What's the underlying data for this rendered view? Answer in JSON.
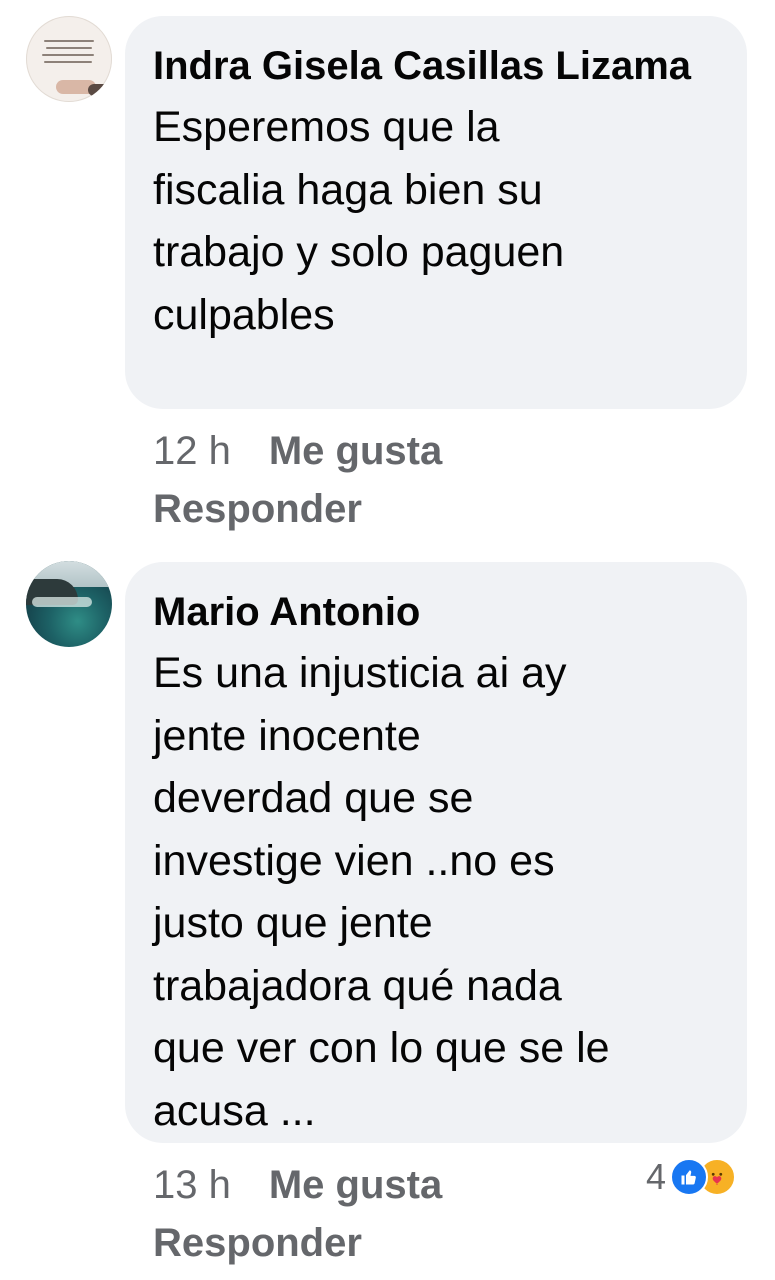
{
  "comments": [
    {
      "author": "Indra Gisela Casillas Lizama",
      "text": "Esperemos que la\nfiscalia haga bien su\ntrabajo y solo paguen\nculpables",
      "time": "12 h",
      "like_label": "Me gusta",
      "reply_label": "Responder",
      "avatar_icon": "quote-profile-photo"
    },
    {
      "author": "Mario Antonio",
      "text": "Es una injusticia ai ay\njente inocente\ndeverdad que se\ninvestige vien ..no es\njusto  que jente\ntrabajadora qué nada\nque ver con lo que se le\nacusa ...",
      "time": "13 h",
      "like_label": "Me gusta",
      "reply_label": "Responder",
      "avatar_icon": "ocean-coast-profile-photo",
      "reactions": {
        "count": "4",
        "icons": [
          "like-icon",
          "care-icon"
        ]
      }
    }
  ],
  "colors": {
    "bubble": "#f0f2f5",
    "text": "#050505",
    "meta": "#65676b",
    "like_blue": "#1877f2"
  }
}
